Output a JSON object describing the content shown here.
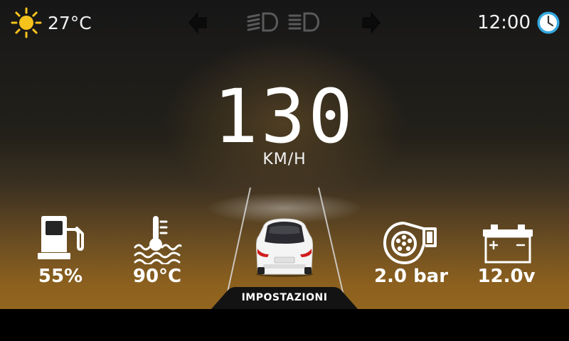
{
  "weather": {
    "temperature": "27°C",
    "icon": "sun-icon",
    "icon_color": "#f6c21c"
  },
  "clock": {
    "time": "12:00",
    "icon": "clock-icon",
    "icon_color": "#35a8e0"
  },
  "nav": {
    "left_icon": "arrow-left-icon",
    "right_icon": "arrow-right-icon"
  },
  "lights": {
    "icons": [
      "low-beam-icon",
      "high-beam-icon"
    ],
    "color": "#5a5a5a"
  },
  "speed": {
    "value": "130",
    "unit": "KM/H"
  },
  "gauges": {
    "fuel": {
      "value": "55%",
      "icon": "fuel-pump-icon"
    },
    "coolant": {
      "value": "90°C",
      "icon": "coolant-temperature-icon"
    },
    "turbo": {
      "value": "2.0 bar",
      "icon": "turbo-icon"
    },
    "battery": {
      "value": "12.0v",
      "icon": "battery-icon"
    }
  },
  "settings": {
    "label": "IMPOSTAZIONI"
  },
  "colors": {
    "accent_amber": "#93661f",
    "background": "#161616"
  }
}
